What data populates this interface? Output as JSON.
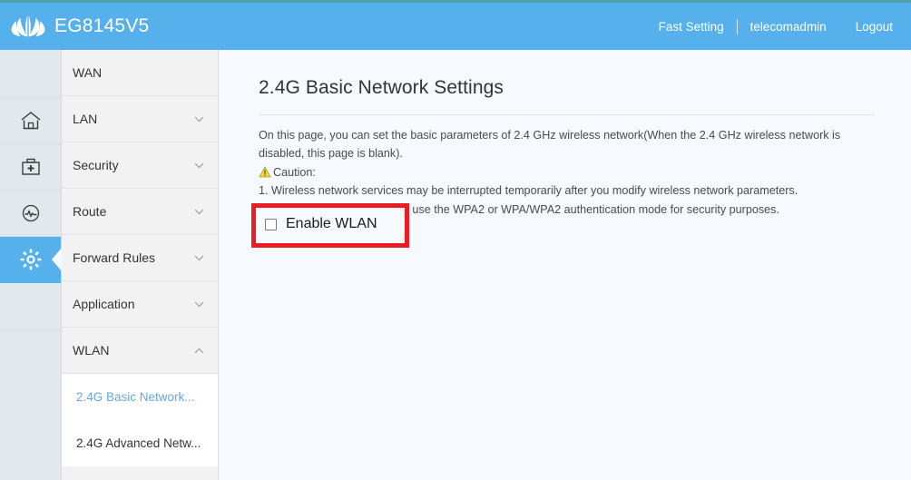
{
  "header": {
    "brand_name": "EG8145V5",
    "logo_icon": "huawei-logo",
    "fast_setting": "Fast Setting",
    "username": "telecomadmin",
    "logout": "Logout",
    "bg_color": "#55b0ec",
    "accent_color": "#4ca3a8"
  },
  "rail": {
    "items": [
      {
        "icon": "home-icon",
        "name": "home",
        "active": false
      },
      {
        "icon": "first-aid-kit-icon",
        "name": "diagnosis",
        "active": false
      },
      {
        "icon": "pulse-monitor-icon",
        "name": "monitor",
        "active": false
      },
      {
        "icon": "gear-icon",
        "name": "settings",
        "active": true
      }
    ],
    "active_color": "#55b0ec"
  },
  "menu": {
    "items": [
      {
        "label": "WAN",
        "chevron": "none",
        "active": false
      },
      {
        "label": "LAN",
        "chevron": "down",
        "active": false
      },
      {
        "label": "Security",
        "chevron": "down",
        "active": false
      },
      {
        "label": "Route",
        "chevron": "down",
        "active": false
      },
      {
        "label": "Forward Rules",
        "chevron": "down",
        "active": false
      },
      {
        "label": "Application",
        "chevron": "down",
        "active": false
      },
      {
        "label": "WLAN",
        "chevron": "up",
        "active": true
      }
    ],
    "submenu": [
      {
        "label": "2.4G Basic Network...",
        "active": true
      },
      {
        "label": "2.4G Advanced Netw...",
        "active": false
      }
    ],
    "active_link_color": "#63a8e2"
  },
  "content": {
    "title": "2.4G Basic Network Settings",
    "description_line1": "On this page, you can set the basic parameters of 2.4 GHz wireless network(When the 2.4 GHz wireless network is disabled, this page is blank).",
    "caution_icon": "warning-triangle-icon",
    "caution_label": "Caution:",
    "caution_item1": "1. Wireless network services may be interrupted temporarily after you modify wireless network parameters.",
    "caution_item2": "2. It is recommended that you use the WPA2 or WPA/WPA2 authentication mode for security purposes.",
    "enable_wlan_label": "Enable WLAN",
    "enable_wlan_checked": false,
    "highlight_color": "#ec1c24"
  }
}
